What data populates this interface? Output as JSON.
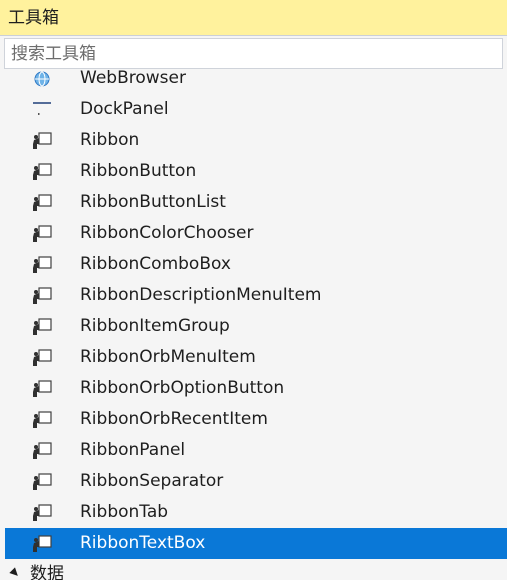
{
  "panel": {
    "title": "工具箱",
    "search_placeholder": "搜索工具箱"
  },
  "items": [
    {
      "label": "WebBrowser",
      "icon": "globe-icon"
    },
    {
      "label": "DockPanel",
      "icon": "dock-panel-icon"
    },
    {
      "label": "Ribbon",
      "icon": "component-icon"
    },
    {
      "label": "RibbonButton",
      "icon": "component-icon"
    },
    {
      "label": "RibbonButtonList",
      "icon": "component-icon"
    },
    {
      "label": "RibbonColorChooser",
      "icon": "component-icon"
    },
    {
      "label": "RibbonComboBox",
      "icon": "component-icon"
    },
    {
      "label": "RibbonDescriptionMenuItem",
      "icon": "component-icon"
    },
    {
      "label": "RibbonItemGroup",
      "icon": "component-icon"
    },
    {
      "label": "RibbonOrbMenuItem",
      "icon": "component-icon"
    },
    {
      "label": "RibbonOrbOptionButton",
      "icon": "component-icon"
    },
    {
      "label": "RibbonOrbRecentItem",
      "icon": "component-icon"
    },
    {
      "label": "RibbonPanel",
      "icon": "component-icon"
    },
    {
      "label": "RibbonSeparator",
      "icon": "component-icon"
    },
    {
      "label": "RibbonTab",
      "icon": "component-icon"
    },
    {
      "label": "RibbonTextBox",
      "icon": "component-icon",
      "selected": true
    }
  ],
  "categories": [
    {
      "label": "数据",
      "icon": "collapse-arrow-icon"
    }
  ],
  "colors": {
    "title_bar": "#fff29d",
    "selection": "#0a78d7",
    "background": "#f5f5f5"
  }
}
